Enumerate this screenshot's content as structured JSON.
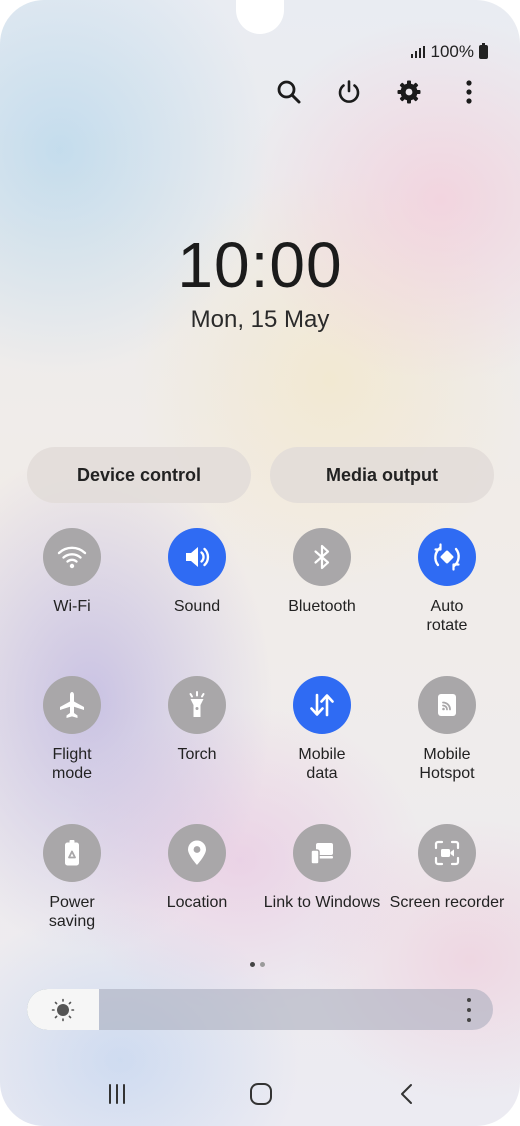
{
  "status_bar": {
    "battery_text": "100%",
    "signal_icon": "signal-icon",
    "battery_icon": "battery-icon"
  },
  "top_actions": [
    {
      "name": "search-button",
      "icon": "search-icon"
    },
    {
      "name": "power-button",
      "icon": "power-icon"
    },
    {
      "name": "settings-button",
      "icon": "gear-icon"
    },
    {
      "name": "more-options-button",
      "icon": "more-vertical-icon"
    }
  ],
  "clock": {
    "time": "10:00",
    "date": "Mon, 15 May"
  },
  "buttons": {
    "device_control": "Device control",
    "media_output": "Media output"
  },
  "tiles": [
    {
      "label": "Wi-Fi",
      "icon": "wifi-icon",
      "on": false
    },
    {
      "label": "Sound",
      "icon": "speaker-icon",
      "on": true
    },
    {
      "label": "Bluetooth",
      "icon": "bluetooth-icon",
      "on": false
    },
    {
      "label": "Auto\nrotate",
      "icon": "auto-rotate-icon",
      "on": true
    },
    {
      "label": "Flight\nmode",
      "icon": "airplane-icon",
      "on": false
    },
    {
      "label": "Torch",
      "icon": "torch-icon",
      "on": false
    },
    {
      "label": "Mobile\ndata",
      "icon": "mobile-data-icon",
      "on": true
    },
    {
      "label": "Mobile\nHotspot",
      "icon": "hotspot-icon",
      "on": false
    },
    {
      "label": "Power\nsaving",
      "icon": "power-saving-icon",
      "on": false
    },
    {
      "label": "Location",
      "icon": "location-icon",
      "on": false
    },
    {
      "label": "Link to Windows",
      "icon": "link-to-windows-icon",
      "on": false
    },
    {
      "label": "Screen recorder",
      "icon": "screen-recorder-icon",
      "on": false
    }
  ],
  "page_indicator": {
    "current_page": 1,
    "total_pages": 2
  },
  "brightness": {
    "level_fraction": 0.155,
    "icon": "sun-icon"
  },
  "colors": {
    "accent": "#2f6bf3",
    "tile_off": "#a9a7a9"
  },
  "navigation": [
    "recent-apps-icon",
    "home-icon",
    "back-icon"
  ]
}
